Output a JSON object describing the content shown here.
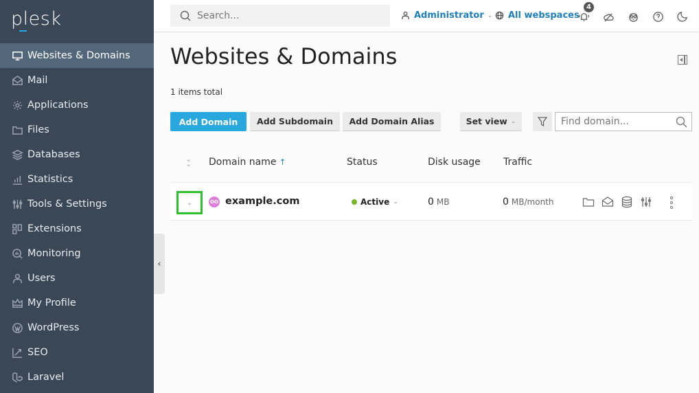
{
  "app": {
    "logo": "plesk"
  },
  "sidebar": {
    "items": [
      {
        "label": "Websites & Domains",
        "icon": "monitor-icon",
        "active": true
      },
      {
        "label": "Mail",
        "icon": "mail-icon"
      },
      {
        "label": "Applications",
        "icon": "gear-icon"
      },
      {
        "label": "Files",
        "icon": "folder-icon"
      },
      {
        "label": "Databases",
        "icon": "layers-icon"
      },
      {
        "label": "Statistics",
        "icon": "bar-chart-icon"
      },
      {
        "label": "Tools & Settings",
        "icon": "sliders-icon"
      },
      {
        "label": "Extensions",
        "icon": "extensions-icon"
      },
      {
        "label": "Monitoring",
        "icon": "monitoring-icon"
      },
      {
        "label": "Users",
        "icon": "user-icon"
      },
      {
        "label": "My Profile",
        "icon": "crown-icon"
      },
      {
        "label": "WordPress",
        "icon": "wordpress-icon"
      },
      {
        "label": "SEO",
        "icon": "seo-icon"
      },
      {
        "label": "Laravel",
        "icon": "laravel-icon"
      }
    ],
    "collapse_glyph": "‹"
  },
  "topbar": {
    "search_placeholder": "Search...",
    "user_label": "Administrator",
    "webspaces_label": "All webspaces",
    "notifications_count": "4"
  },
  "page": {
    "title": "Websites & Domains",
    "items_total": "1 items total"
  },
  "toolbar": {
    "add_domain": "Add Domain",
    "add_subdomain": "Add Subdomain",
    "add_domain_alias": "Add Domain Alias",
    "set_view": "Set view",
    "find_placeholder": "Find domain..."
  },
  "table": {
    "columns": [
      "Domain name",
      "Status",
      "Disk usage",
      "Traffic"
    ],
    "sort_indicator": "↑",
    "rows": [
      {
        "avatar": "OO",
        "domain": "example.com",
        "status": "Active",
        "status_color": "#77b52a",
        "disk_value": "0",
        "disk_unit": "MB",
        "traffic_value": "0",
        "traffic_unit": "MB/month"
      }
    ]
  },
  "colors": {
    "primary": "#28a8dd",
    "sidebar": "#3a4757",
    "sidebar_active": "#53677a",
    "link": "#1f7fb9",
    "highlight": "#2dc22d"
  }
}
